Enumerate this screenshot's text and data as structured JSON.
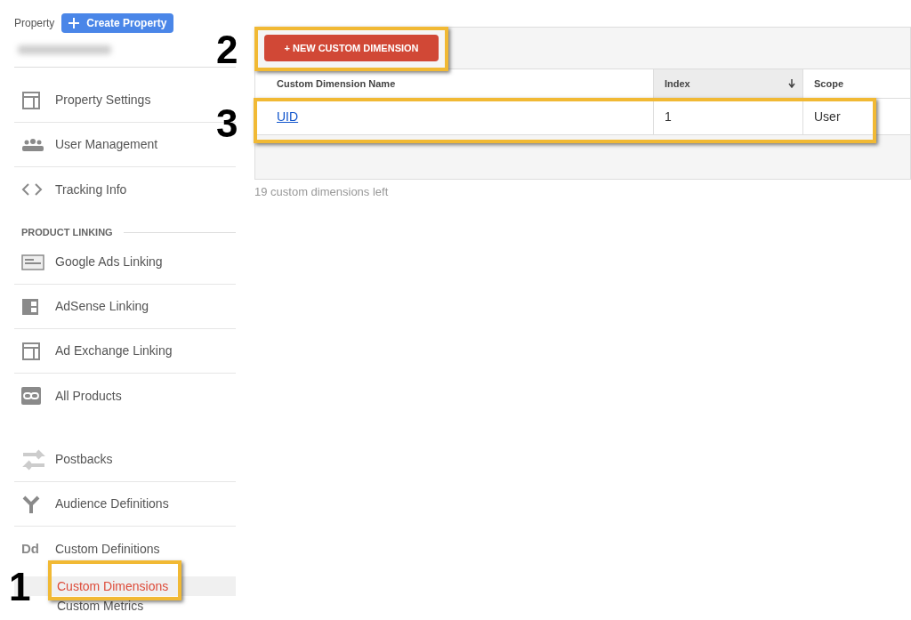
{
  "header": {
    "label": "Property",
    "create_button": "Create Property"
  },
  "sidebar": {
    "groups": [
      {
        "items": [
          {
            "kind": "settings",
            "label": "Property Settings"
          },
          {
            "kind": "users",
            "label": "User Management"
          },
          {
            "kind": "code",
            "label": "Tracking Info"
          }
        ]
      },
      {
        "heading": "PRODUCT LINKING",
        "items": [
          {
            "kind": "ads",
            "label": "Google Ads Linking"
          },
          {
            "kind": "adsense",
            "label": "AdSense Linking"
          },
          {
            "kind": "settings",
            "label": "Ad Exchange Linking"
          },
          {
            "kind": "link",
            "label": "All Products"
          }
        ]
      },
      {
        "items": [
          {
            "kind": "postbacks",
            "label": "Postbacks"
          },
          {
            "kind": "audience",
            "label": "Audience Definitions"
          },
          {
            "kind": "definitions",
            "icon_text": "Dd",
            "label": "Custom Definitions",
            "children": [
              {
                "label": "Custom Dimensions",
                "selected": true
              },
              {
                "label": "Custom Metrics",
                "selected": false
              }
            ]
          }
        ]
      }
    ]
  },
  "new_button": "+ NEW CUSTOM DIMENSION",
  "table": {
    "columns": [
      {
        "label": "Custom Dimension Name",
        "sorted": false
      },
      {
        "label": "Index",
        "sorted": true
      },
      {
        "label": "Scope",
        "sorted": false
      }
    ],
    "rows": [
      {
        "name": "UID",
        "index": "1",
        "scope": "User"
      }
    ]
  },
  "footer": "19 custom dimensions left",
  "callouts": [
    "1",
    "2",
    "3"
  ]
}
